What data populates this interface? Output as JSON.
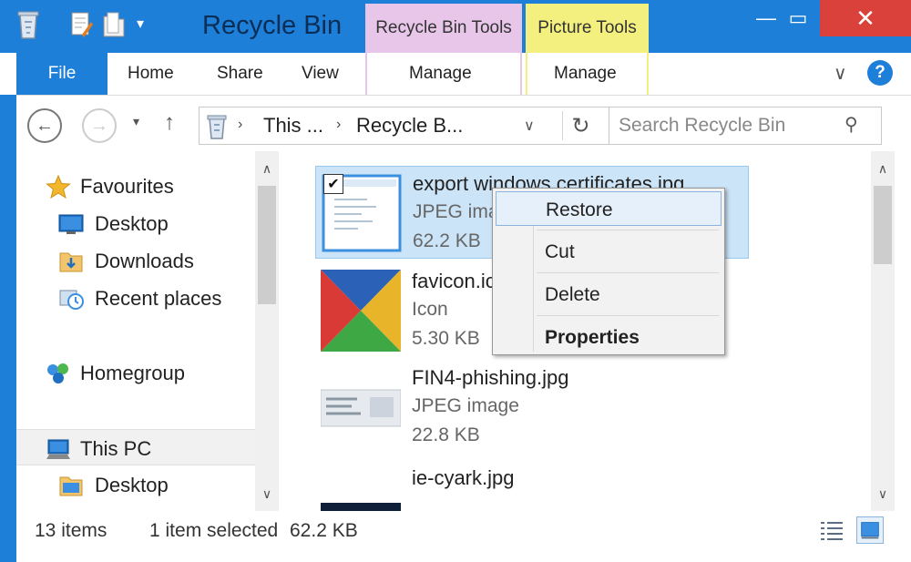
{
  "window": {
    "title": "Recycle Bin",
    "accent": "#1e7fd8",
    "close_color": "#d9413a",
    "minimize_glyph": "—",
    "maximize_glyph": "▭",
    "close_glyph": "✕",
    "qa_dropdown_glyph": "▾"
  },
  "context_tabs": {
    "recycle_bin_tools": "Recycle Bin Tools",
    "picture_tools": "Picture Tools",
    "recycle_bin_color": "#e8c6ea",
    "picture_color": "#f3f080"
  },
  "ribbon": {
    "file": "File",
    "home": "Home",
    "share": "Share",
    "view": "View",
    "manage_rb": "Manage",
    "manage_pic": "Manage",
    "collapse_glyph": "∨",
    "help_glyph": "?"
  },
  "address": {
    "back_glyph": "←",
    "forward_glyph": "→",
    "recent_glyph": "▾",
    "up_glyph": "↑",
    "segment1": "This ...",
    "segment2": "Recycle B...",
    "sep_glyph": "›",
    "dropdown_glyph": "∨",
    "refresh_glyph": "↻"
  },
  "search": {
    "placeholder": "Search Recycle Bin",
    "icon_glyph": "⚲"
  },
  "nav": {
    "favourites": "Favourites",
    "desktop": "Desktop",
    "downloads": "Downloads",
    "recent_places": "Recent places",
    "homegroup": "Homegroup",
    "this_pc": "This PC",
    "pc_desktop": "Desktop"
  },
  "scroll": {
    "up_glyph": "∧",
    "down_glyph": "∨"
  },
  "files": [
    {
      "name": "export windows certificates.jpg",
      "type": "JPEG image",
      "size": "62.2 KB",
      "selected": true
    },
    {
      "name": "favicon.ico",
      "type": "Icon",
      "size": "5.30 KB"
    },
    {
      "name": "FIN4-phishing.jpg",
      "type": "JPEG image",
      "size": "22.8 KB"
    },
    {
      "name": "ie-cyark.jpg",
      "type": "",
      "size": ""
    }
  ],
  "checkbox_glyph": "✔",
  "context_menu": {
    "restore": "Restore",
    "cut": "Cut",
    "delete": "Delete",
    "properties": "Properties"
  },
  "status": {
    "items": "13 items",
    "selected": "1 item selected",
    "size": "62.2 KB"
  }
}
